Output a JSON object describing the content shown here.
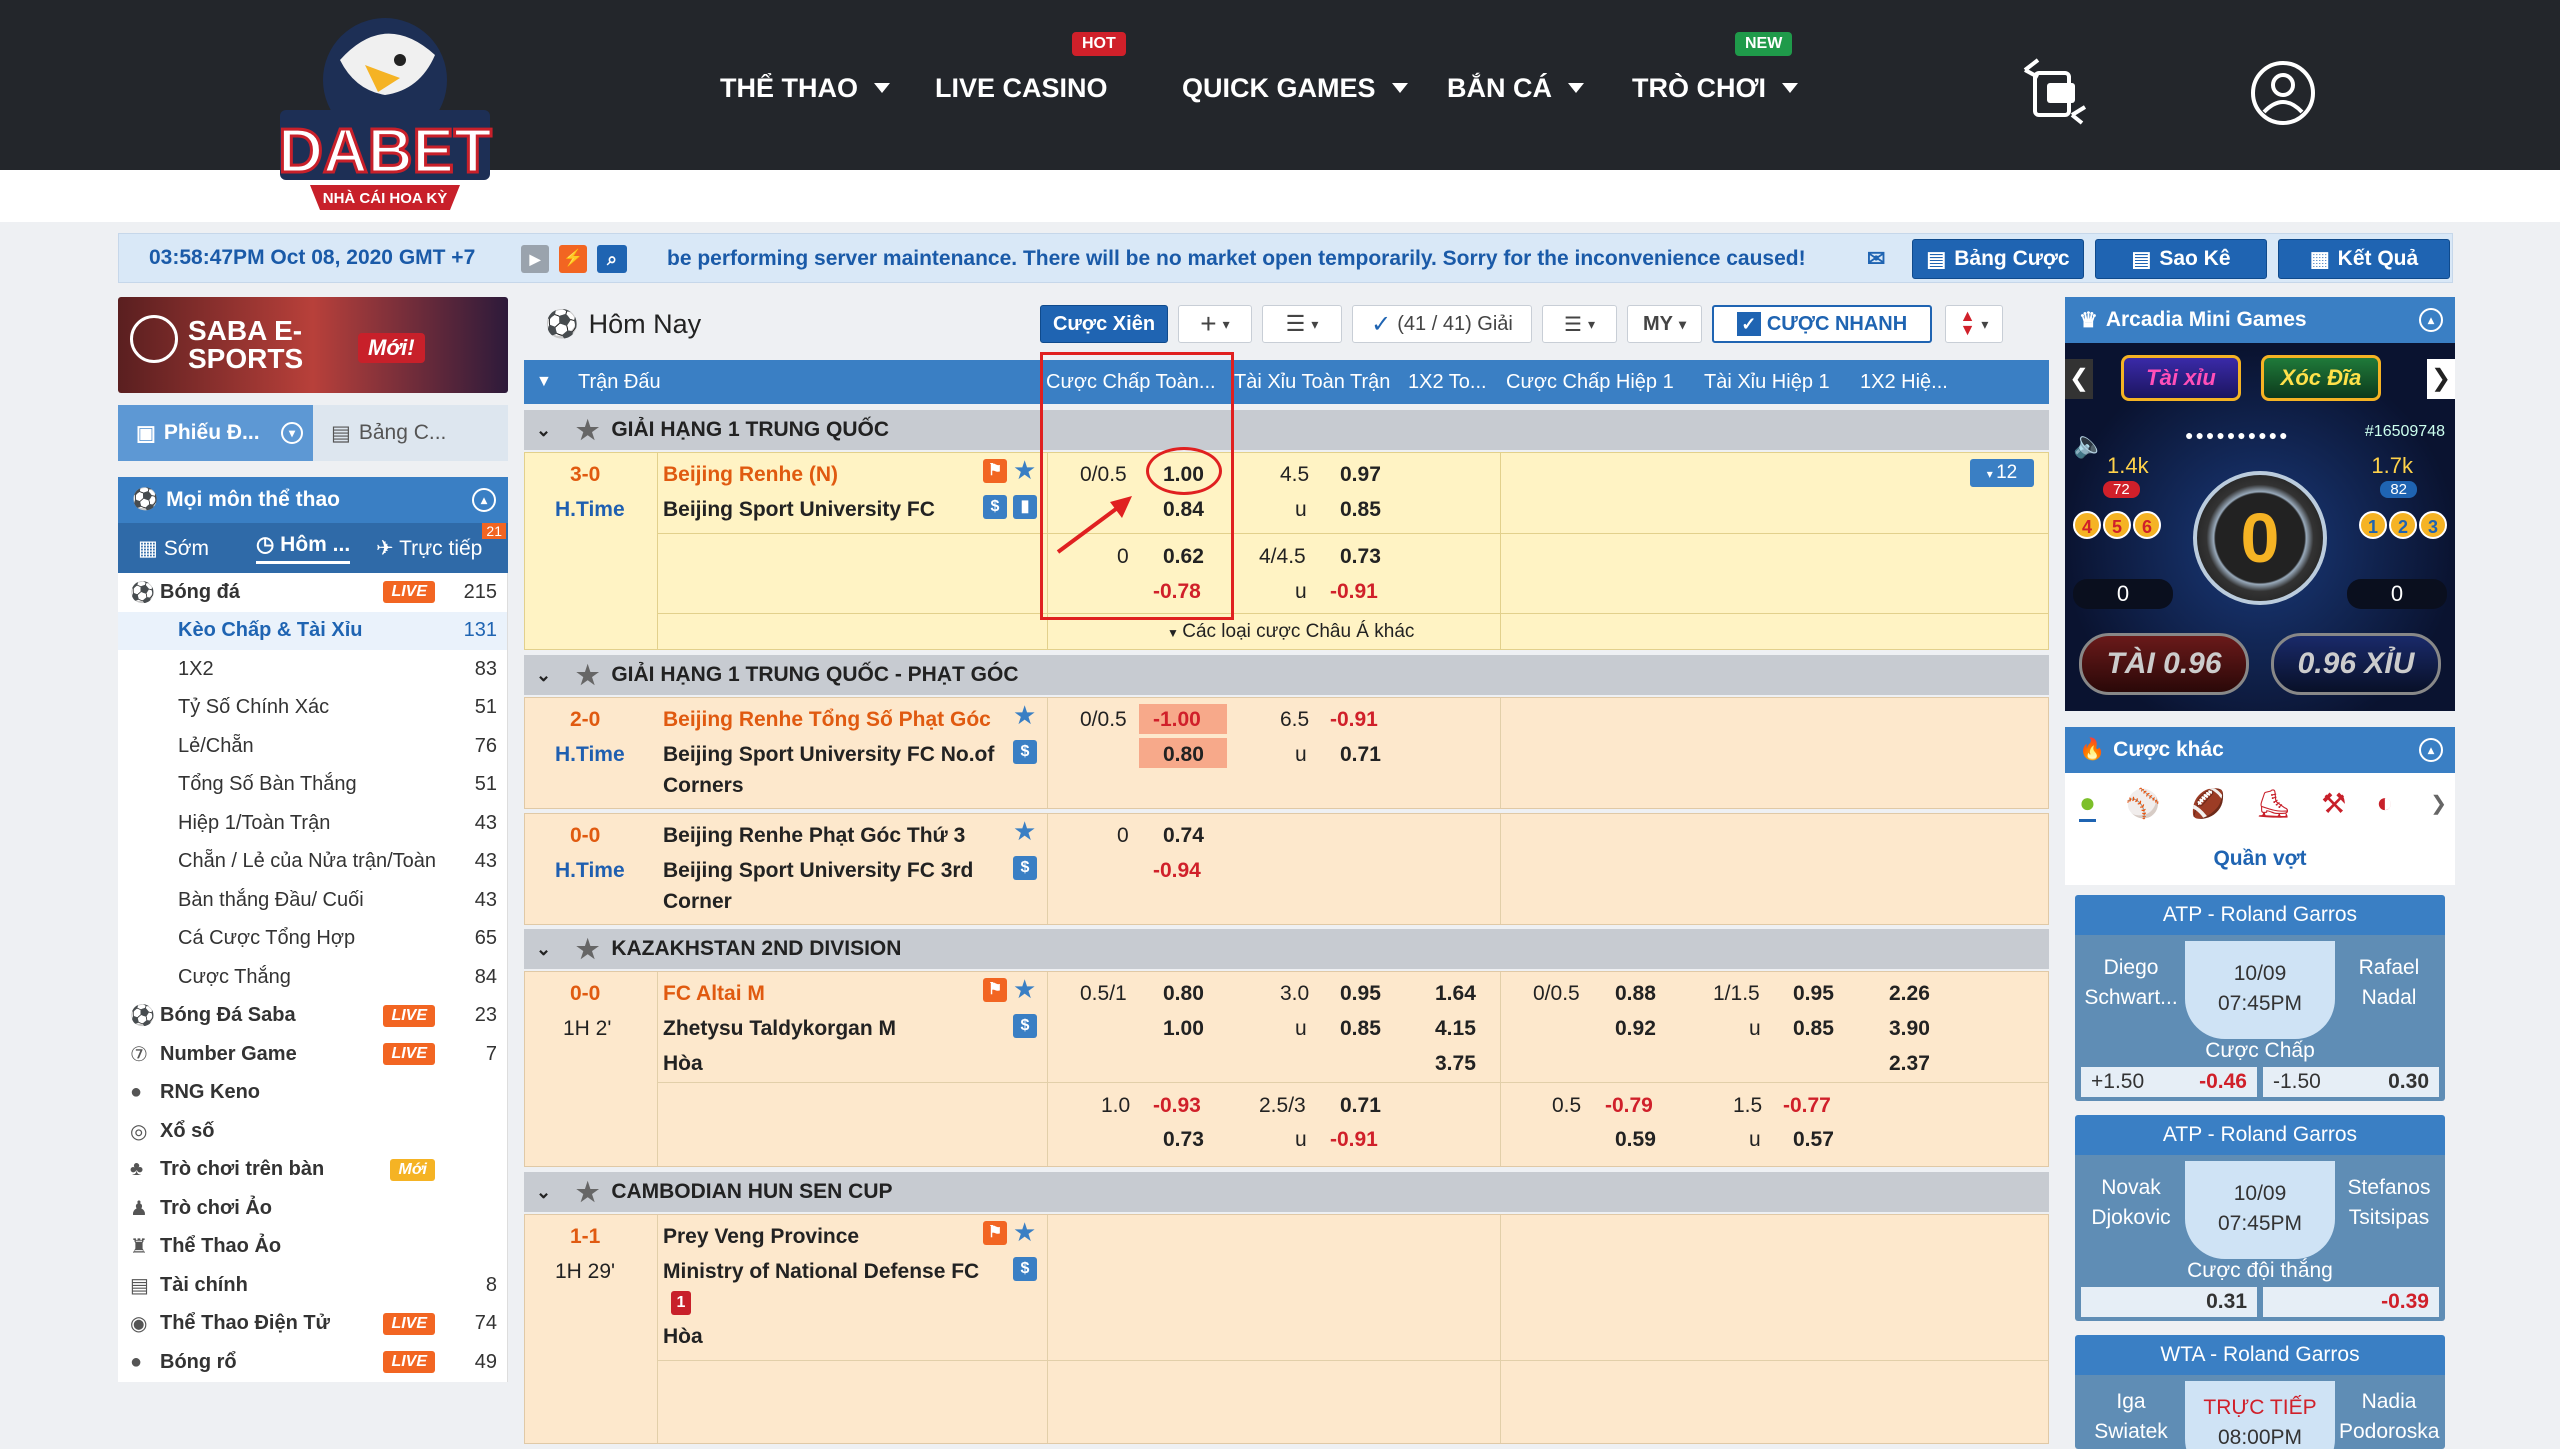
{
  "header": {
    "logo_text": "DABET",
    "logo_sub": "NHÀ CÁI HOA KỲ",
    "nav": [
      {
        "label": "THỂ THAO",
        "badge": ""
      },
      {
        "label": "LIVE CASINO",
        "badge": "HOT"
      },
      {
        "label": "QUICK GAMES",
        "badge": ""
      },
      {
        "label": "BẮN CÁ",
        "badge": ""
      },
      {
        "label": "TRÒ CHƠI",
        "badge": "NEW"
      }
    ]
  },
  "infobar": {
    "time": "03:58:47PM Oct 08, 2020 GMT +7",
    "message": "be performing server maintenance. There will be no market open temporarily. Sorry for the inconvenience caused!",
    "buttons": [
      "Bảng Cược",
      "Sao Kê",
      "Kết Quả"
    ]
  },
  "sidebar": {
    "banner_text": "SABA E-SPORTS",
    "banner_badge": "Mới!",
    "tabs": [
      "Phiếu Đ...",
      "Bảng C..."
    ],
    "sports_title": "Mọi môn thể thao",
    "time_tabs": [
      "Sớm",
      "Hôm ...",
      "Trực tiếp"
    ],
    "live_count": "21",
    "sports": [
      {
        "label": "Bóng đá",
        "badge": "LIVE",
        "count": "215",
        "sub": false
      },
      {
        "label": "Kèo Chấp & Tài Xỉu",
        "badge": "",
        "count": "131",
        "sub": true,
        "active": true
      },
      {
        "label": "1X2",
        "badge": "",
        "count": "83",
        "sub": true
      },
      {
        "label": "Tỷ Số Chính Xác",
        "badge": "",
        "count": "51",
        "sub": true
      },
      {
        "label": "Lẻ/Chẵn",
        "badge": "",
        "count": "76",
        "sub": true
      },
      {
        "label": "Tổng Số Bàn Thắng",
        "badge": "",
        "count": "51",
        "sub": true
      },
      {
        "label": "Hiệp 1/Toàn Trận",
        "badge": "",
        "count": "43",
        "sub": true
      },
      {
        "label": "Chẵn / Lẻ của Nửa trận/Toàn",
        "badge": "",
        "count": "43",
        "sub": true
      },
      {
        "label": "Bàn thắng Đầu/ Cuối",
        "badge": "",
        "count": "43",
        "sub": true
      },
      {
        "label": "Cá Cược Tổng Hợp",
        "badge": "",
        "count": "65",
        "sub": true
      },
      {
        "label": "Cược Thắng",
        "badge": "",
        "count": "84",
        "sub": true
      },
      {
        "label": "Bóng Đá Saba",
        "badge": "LIVE",
        "count": "23",
        "sub": false
      },
      {
        "label": "Number Game",
        "badge": "LIVE",
        "count": "7",
        "sub": false
      },
      {
        "label": "RNG Keno",
        "badge": "",
        "count": "",
        "sub": false
      },
      {
        "label": "Xổ số",
        "badge": "",
        "count": "",
        "sub": false
      },
      {
        "label": "Trò chơi trên bàn",
        "badge": "Mới",
        "count": "",
        "sub": false
      },
      {
        "label": "Trò chơi Ảo",
        "badge": "",
        "count": "",
        "sub": false
      },
      {
        "label": "Thể Thao Ảo",
        "badge": "",
        "count": "",
        "sub": false
      },
      {
        "label": "Tài chính",
        "badge": "",
        "count": "8",
        "sub": false
      },
      {
        "label": "Thể Thao Điện Tử",
        "badge": "LIVE",
        "count": "74",
        "sub": false
      },
      {
        "label": "Bóng rổ",
        "badge": "LIVE",
        "count": "49",
        "sub": false
      }
    ]
  },
  "toolbar": {
    "title": "Hôm Nay",
    "parlay": "Cược Xiên",
    "leagues": "(41 / 41) Giải",
    "odds_type": "MY",
    "quick_bet": "CƯỢC NHANH"
  },
  "columns": [
    "Trận Đấu",
    "Cược Chấp Toàn...",
    "Tài Xỉu Toàn Trận",
    "1X2 To...",
    "Cược Chấp Hiệp 1",
    "Tài Xỉu Hiệp 1",
    "1X2 Hiệ..."
  ],
  "leagues": [
    {
      "name": "GIẢI HẠNG 1 TRUNG QUỐC"
    },
    {
      "name": "GIẢI HẠNG 1 TRUNG QUỐC - PHẠT GÓC"
    },
    {
      "name": "KAZAKHSTAN 2ND DIVISION"
    },
    {
      "name": "CAMBODIAN HUN SEN CUP"
    }
  ],
  "matches": {
    "m1": {
      "score": "3-0",
      "time": "H.Time",
      "home": "Beijing Renhe (N)",
      "away": "Beijing Sport University FC",
      "more": "12",
      "hdp1": "0/0.5",
      "hdp1_h": "1.00",
      "hdp1_a": "0.84",
      "ou1": "4.5",
      "ou1_o": "0.97",
      "ou1_u": "u",
      "ou1_uv": "0.85",
      "hdp2": "0",
      "hdp2_h": "0.62",
      "hdp2_a": "-0.78",
      "ou2": "4/4.5",
      "ou2_o": "0.73",
      "ou2_u": "u",
      "ou2_uv": "-0.91",
      "other": "Các loại cược Châu Á khác"
    },
    "m2": {
      "score": "2-0",
      "time": "H.Time",
      "home": "Beijing Renhe Tổng Số Phạt Góc",
      "away": "Beijing Sport University FC No.of",
      "away2": "Corners",
      "hdp": "0/0.5",
      "hdp_h": "-1.00",
      "hdp_a": "0.80",
      "ou": "6.5",
      "ou_o": "-0.91",
      "ou_u": "u",
      "ou_uv": "0.71"
    },
    "m3": {
      "score": "0-0",
      "time": "H.Time",
      "home": "Beijing Renhe Phạt Góc Thứ 3",
      "away": "Beijing Sport University FC 3rd",
      "away2": "Corner",
      "hdp": "0",
      "hdp_h": "0.74",
      "hdp_a": "-0.94"
    },
    "m4": {
      "score": "0-0",
      "time": "1H 2'",
      "home": "FC Altai M",
      "away": "Zhetysu Taldykorgan M",
      "draw": "Hòa",
      "hdp": "0.5/1",
      "hdp_h": "0.80",
      "hdp_a": "1.00",
      "ou": "3.0",
      "ou_o": "0.95",
      "ou_u": "u",
      "ou_uv": "0.85",
      "x1": "1.64",
      "x2": "4.15",
      "xd": "3.75",
      "h1": "0/0.5",
      "h1_h": "0.88",
      "h1_a": "0.92",
      "ou1": "1/1.5",
      "ou1_o": "0.95",
      "ou1_u": "u",
      "ou1_uv": "0.85",
      "hx1": "2.26",
      "hx2": "3.90",
      "hxd": "2.37",
      "r2_hdp": "1.0",
      "r2_h": "-0.93",
      "r2_a": "0.73",
      "r2_ou": "2.5/3",
      "r2_o": "0.71",
      "r2_u": "u",
      "r2_uv": "-0.91",
      "r2_h1": "0.5",
      "r2_h1h": "-0.79",
      "r2_h1a": "0.59",
      "r2_ou1": "1.5",
      "r2_ou1o": "-0.77",
      "r2_ou1u": "u",
      "r2_ou1uv": "0.57"
    },
    "m5": {
      "score": "1-1",
      "time": "1H 29'",
      "home": "Prey Veng Province",
      "away": "Ministry of National Defense FC",
      "draw": "Hòa"
    }
  },
  "right": {
    "mini_title": "Arcadia Mini Games",
    "game_tabs": [
      "Tài xỉu",
      "Xóc Đĩa"
    ],
    "game_id": "#16509748",
    "left_amount": "1.4k",
    "left_count": "72",
    "right_amount": "1.7k",
    "right_count": "82",
    "left_dice": [
      "4",
      "5",
      "6"
    ],
    "right_dice": [
      "1",
      "2",
      "3"
    ],
    "center": "0",
    "left_zero": "0",
    "right_zero": "0",
    "tai": "TÀI 0.96",
    "xiu": "0.96 XỈU",
    "other_title": "Cược khác",
    "sport_label": "Quần vợt",
    "cards": [
      {
        "title": "ATP - Roland Garros",
        "p1": "Diego Schwart...",
        "date": "10/09",
        "time": "07:45PM",
        "p2": "Rafael Nadal",
        "market": "Cược Chấp",
        "o1": "+1.50",
        "v1": "-0.46",
        "o2": "-1.50",
        "v2": "0.30"
      },
      {
        "title": "ATP - Roland Garros",
        "p1": "Novak Djokovic",
        "date": "10/09",
        "time": "07:45PM",
        "p2": "Stefanos Tsitsipas",
        "market": "Cược đội thắng",
        "v1": "0.31",
        "v2": "-0.39"
      },
      {
        "title": "WTA - Roland Garros",
        "p1": "Iga Swiatek",
        "date": "TRỰC TIẾP",
        "time": "08:00PM",
        "p2": "Nadia Podoroska"
      }
    ]
  }
}
